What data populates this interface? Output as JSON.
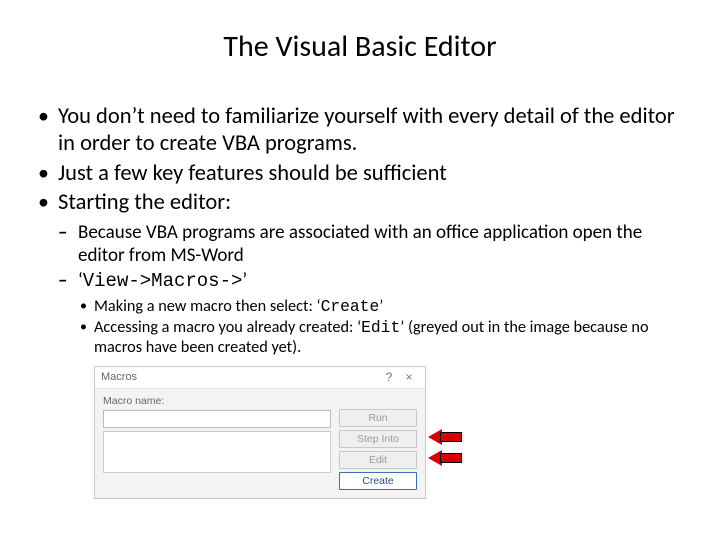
{
  "title": "The Visual Basic Editor",
  "bullets": {
    "b1": "You don’t need to familiarize yourself with every detail of the editor in order to create VBA programs.",
    "b2": "Just a few key features should be sufficient",
    "b3": "Starting the editor:",
    "s1": "Because VBA programs are associated with an office application open the editor from MS-Word",
    "s2_pre": "‘",
    "s2_code": "View->Macros->",
    "s2_post": "’",
    "t1_pre": "Making a new macro then select: ‘",
    "t1_code": "Create",
    "t1_post": "’",
    "t2_pre": "Accessing a macro you already created: ‘",
    "t2_code": "Edit",
    "t2_post": "’ (greyed out in the image because no macros have been created yet)."
  },
  "dialog": {
    "title": "Macros",
    "help": "?",
    "close": "×",
    "label_name": "Macro name:",
    "buttons": {
      "run": "Run",
      "stepinto": "Step Into",
      "edit": "Edit",
      "create": "Create"
    }
  }
}
